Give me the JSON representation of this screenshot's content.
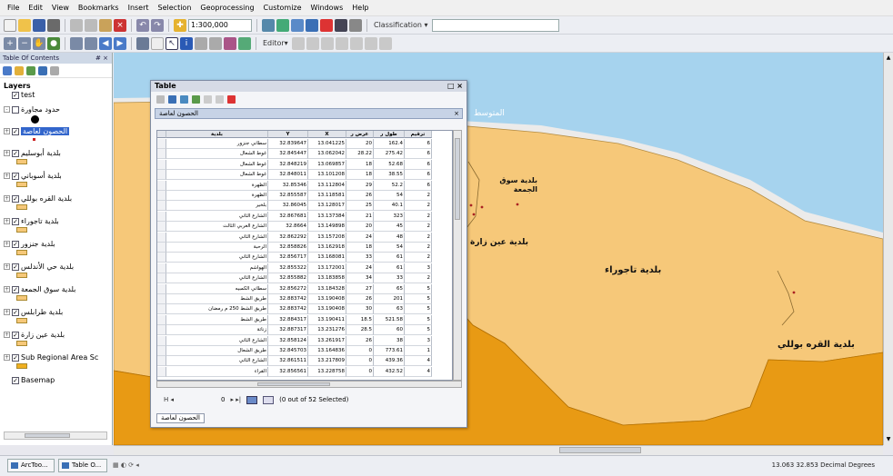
{
  "menu": [
    "File",
    "Edit",
    "View",
    "Bookmarks",
    "Insert",
    "Selection",
    "Geoprocessing",
    "Customize",
    "Windows",
    "Help"
  ],
  "toolbar": {
    "scale": "1:300,000",
    "classification_label": "Classification ▾",
    "editor_label": "Editor▾"
  },
  "toc": {
    "title": "Table Of Contents",
    "close": "# ×",
    "layers_label": "Layers",
    "layers": [
      {
        "name": "test",
        "checked": "✓",
        "expand": ""
      },
      {
        "name": "حدود مجاورة",
        "checked": "",
        "expand": "-"
      },
      {
        "name": "الحصون لعاصة",
        "checked": "✓",
        "expand": "+",
        "selected": true
      },
      {
        "name": "بلدية أبوسليم",
        "checked": "✓",
        "expand": "+"
      },
      {
        "name": "بلدية أسوباني",
        "checked": "✓",
        "expand": "+"
      },
      {
        "name": "بلدية القره بوللي",
        "checked": "✓",
        "expand": "+"
      },
      {
        "name": "بلدية تاجوراء",
        "checked": "✓",
        "expand": "+"
      },
      {
        "name": "بلدية جنزور",
        "checked": "✓",
        "expand": "+"
      },
      {
        "name": "بلدية حي الأندلس",
        "checked": "✓",
        "expand": "+"
      },
      {
        "name": "بلدية سوق الجمعة",
        "checked": "✓",
        "expand": "+"
      },
      {
        "name": "بلدية طرابلس",
        "checked": "✓",
        "expand": "+"
      },
      {
        "name": "بلدية عين زارة",
        "checked": "✓",
        "expand": "+"
      },
      {
        "name": "Sub Regional Area Sc",
        "checked": "✓",
        "expand": "+"
      },
      {
        "name": "Basemap",
        "checked": "✓",
        "expand": ""
      }
    ]
  },
  "table_window": {
    "title": "Table",
    "tab_name": "الحصون لعاصة",
    "headers": [
      "بلدية",
      "Y",
      "X",
      "عرض ر",
      "طول ر",
      "ترقيم"
    ],
    "rows": [
      [
        "سطاني جنزور",
        "32.839647",
        "13.041225",
        "20",
        "162.4",
        "6"
      ],
      [
        "غوط الشعال",
        "32.845447",
        "13.062042",
        "28.22",
        "275.42",
        "6"
      ],
      [
        "غوط الشعال",
        "32.848219",
        "13.069857",
        "18",
        "52.68",
        "6"
      ],
      [
        "غوط الشعال",
        "32.848011",
        "13.101208",
        "18",
        "38.55",
        "6"
      ],
      [
        "الظهرة",
        "32.85346",
        "13.112804",
        "29",
        "52.2",
        "6"
      ],
      [
        "الظهرة",
        "32.855587",
        "13.118581",
        "26",
        "54",
        "2"
      ],
      [
        "بلخير",
        "32.86045",
        "13.128017",
        "25",
        "40.1",
        "2"
      ],
      [
        "الشارع الثاني",
        "32.867681",
        "13.137384",
        "21",
        "323",
        "2"
      ],
      [
        "الشارع الغربي الثالث",
        "32.8664",
        "13.149898",
        "20",
        "45",
        "2"
      ],
      [
        "الشارع الثاني",
        "32.862292",
        "13.157208",
        "24",
        "48",
        "2"
      ],
      [
        "الرحبة",
        "32.858826",
        "13.162918",
        "18",
        "54",
        "2"
      ],
      [
        "الشارع الثاني",
        "32.856717",
        "13.168081",
        "33",
        "61",
        "2"
      ],
      [
        "الهواشم",
        "32.855322",
        "13.172001",
        "24",
        "61",
        "3"
      ],
      [
        "الشارع الثاني",
        "32.855882",
        "13.183858",
        "34",
        "33",
        "2"
      ],
      [
        "سطاني الكمبيه",
        "32.856272",
        "13.184328",
        "27",
        "65",
        "5"
      ],
      [
        "طريق الشط",
        "32.883742",
        "13.190408",
        "26",
        "201",
        "5"
      ],
      [
        "طريق الشط 250 م رمضان",
        "32.883742",
        "13.190408",
        "30",
        "63",
        "5"
      ],
      [
        "طريق الشط",
        "32.884317",
        "13.190411",
        "18.5",
        "521.58",
        "5"
      ],
      [
        "زناتة",
        "32.887317",
        "13.231276",
        "28.5",
        "60",
        "5"
      ],
      [
        "الشارع الثاني",
        "32.858124",
        "13.261917",
        "26",
        "38",
        "3"
      ],
      [
        "طريق الشعال",
        "32.845703",
        "13.164836",
        "0",
        "773.61",
        "1"
      ],
      [
        "الشارع الثاني",
        "32.861511",
        "13.217809",
        "0",
        "439.36",
        "4"
      ],
      [
        "القراء",
        "32.856561",
        "13.228758",
        "0",
        "432.52",
        "4"
      ]
    ],
    "nav_first": "H ◂",
    "nav_current": "0",
    "nav_next": "▸ ▸|",
    "selected_text": "(0 out of 52 Selected)",
    "bottom_tab": "الحصون لعاصة"
  },
  "map_labels": [
    {
      "text": "بلدية سوق الجمعة"
    },
    {
      "text": "بلدية عين زارة"
    },
    {
      "text": "بلدية تاجوراء"
    },
    {
      "text": "بلدية القره بوللي"
    },
    {
      "text": "المتوسط"
    }
  ],
  "status": {
    "task1": "ArcToo...",
    "task2": "Table O...",
    "coords": "13.063  32.853 Decimal Degrees"
  },
  "colors": {
    "sea": "#a6d3ee",
    "land": "#f6c879",
    "land_dark": "#e89a14",
    "basemap_grey": "#ecebea"
  }
}
